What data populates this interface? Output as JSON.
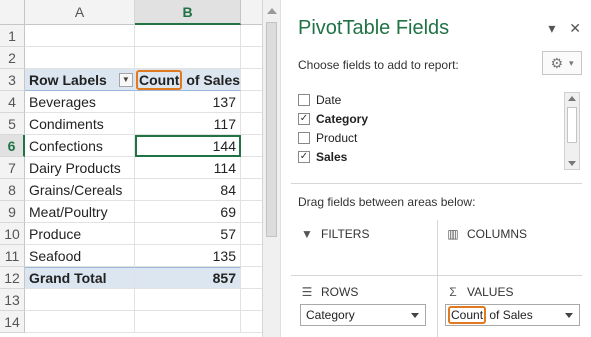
{
  "sheet": {
    "columns": [
      "A",
      "B"
    ],
    "row_numbers": [
      "1",
      "2",
      "3",
      "4",
      "5",
      "6",
      "7",
      "8",
      "9",
      "10",
      "11",
      "12",
      "13",
      "14"
    ],
    "header": {
      "row_labels": "Row Labels",
      "count": "Count",
      "of_sales": " of Sales"
    },
    "rows": [
      {
        "label": "Beverages",
        "value": "137"
      },
      {
        "label": "Condiments",
        "value": "117"
      },
      {
        "label": "Confections",
        "value": "144"
      },
      {
        "label": "Dairy Products",
        "value": "114"
      },
      {
        "label": "Grains/Cereals",
        "value": "84"
      },
      {
        "label": "Meat/Poultry",
        "value": "69"
      },
      {
        "label": "Produce",
        "value": "57"
      },
      {
        "label": "Seafood",
        "value": "135"
      }
    ],
    "total": {
      "label": "Grand Total",
      "value": "857"
    },
    "accent_color": "#217346",
    "highlight_color": "#e07a20"
  },
  "panel": {
    "title": "PivotTable Fields",
    "dropdown_glyph": "▾",
    "close_glyph": "✕",
    "choose_text": "Choose fields to add to report:",
    "gear_icon": "⚙",
    "fields": [
      {
        "name": "Date",
        "checked": false
      },
      {
        "name": "Category",
        "checked": true
      },
      {
        "name": "Product",
        "checked": false
      },
      {
        "name": "Sales",
        "checked": true
      }
    ],
    "drag_text": "Drag fields between areas below:",
    "areas": {
      "filters": "FILTERS",
      "columns": "COLUMNS",
      "rows": "ROWS",
      "values": "VALUES"
    },
    "rows_field": "Category",
    "values_field_count": "Count",
    "values_field_rest": " of Sales",
    "check_glyph": "✓"
  }
}
